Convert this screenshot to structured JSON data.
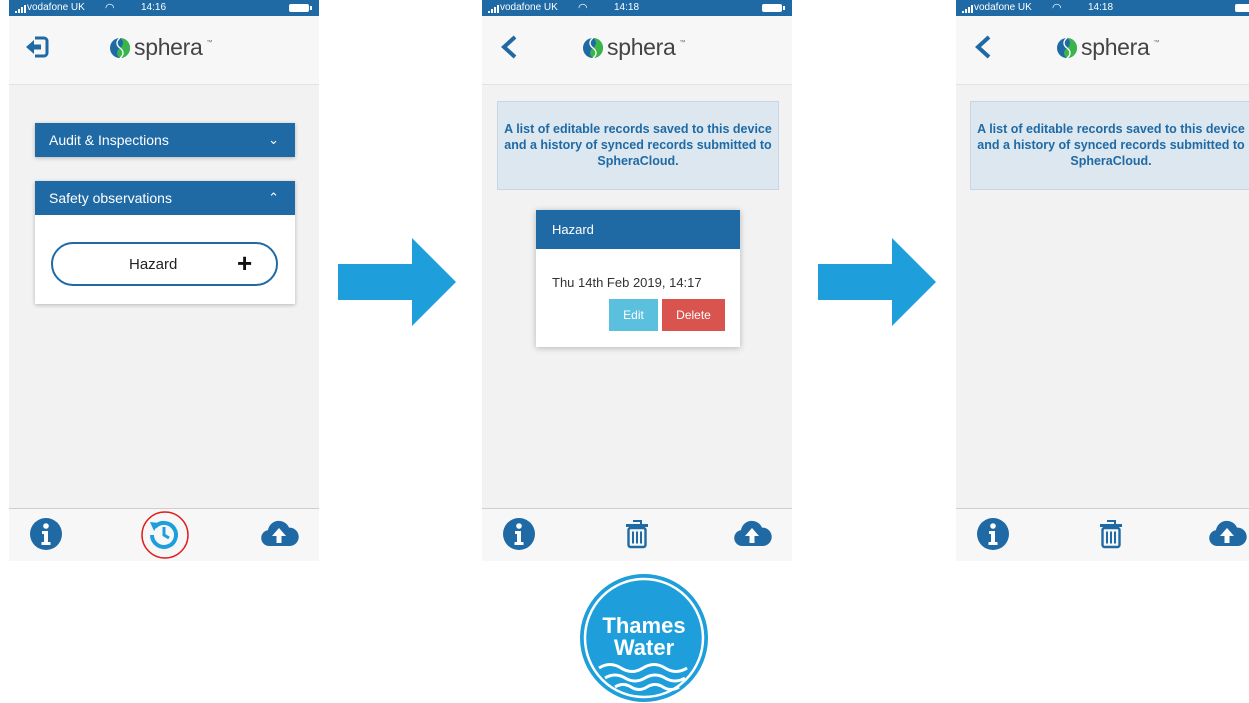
{
  "colors": {
    "primary": "#1f6aa5",
    "arrow": "#1e9fdb",
    "edit": "#5bc0de",
    "delete": "#d9534f",
    "highlight": "#e02020",
    "banner_bg": "#dce7ef"
  },
  "screens": [
    {
      "status": {
        "carrier": "vodafone UK",
        "time": "14:16"
      },
      "logo": "sphera",
      "nav_icon": "logout-icon",
      "accordions": [
        {
          "title": "Audit & Inspections",
          "state": "collapsed"
        },
        {
          "title": "Safety observations",
          "state": "expanded",
          "items": [
            "Hazard"
          ]
        }
      ],
      "bottom_icons": [
        "info-icon",
        "history-icon",
        "cloud-upload-icon"
      ]
    },
    {
      "status": {
        "carrier": "vodafone UK",
        "time": "14:18"
      },
      "logo": "sphera",
      "nav_icon": "back-chevron-icon",
      "banner": "A list of editable records saved to this device and a history of synced records submitted to SpheraCloud.",
      "record": {
        "title": "Hazard",
        "date": "Thu 14th Feb 2019, 14:17",
        "edit_label": "Edit",
        "delete_label": "Delete"
      },
      "bottom_icons": [
        "info-icon",
        "trash-icon",
        "cloud-upload-icon"
      ]
    },
    {
      "status": {
        "carrier": "vodafone UK",
        "time": "14:18"
      },
      "logo": "sphera",
      "nav_icon": "back-chevron-icon",
      "banner": "A list of editable records saved to this device and a history of synced records submitted to SpheraCloud.",
      "bottom_icons": [
        "info-icon",
        "trash-icon",
        "cloud-upload-icon"
      ]
    }
  ],
  "thames_logo": {
    "line1": "Thames",
    "line2": "Water"
  }
}
